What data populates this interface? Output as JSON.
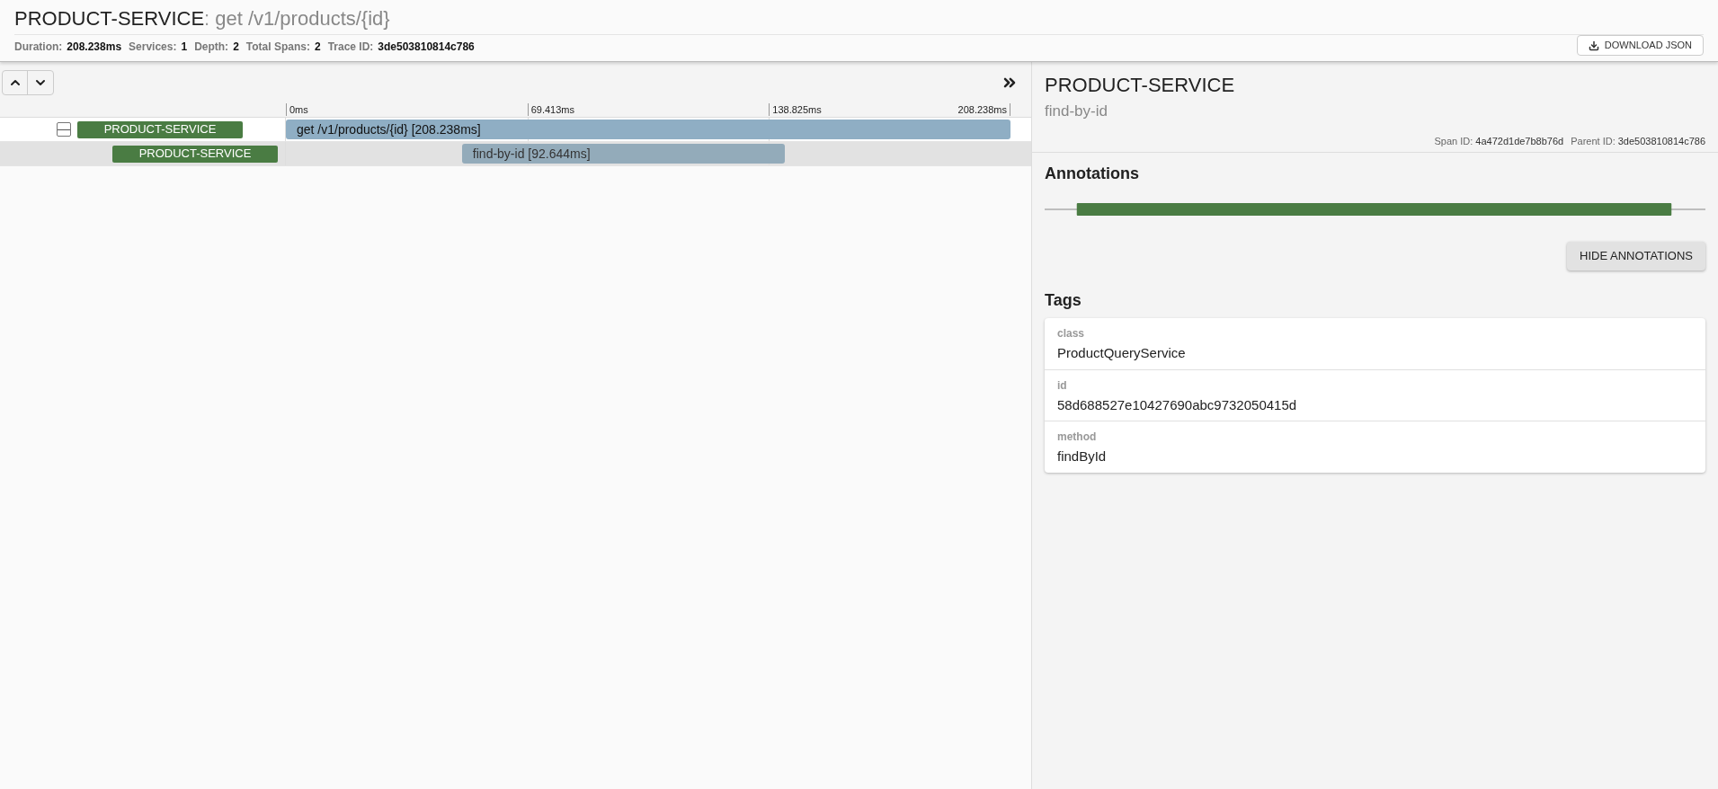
{
  "header": {
    "service": "PRODUCT-SERVICE",
    "separator": ":",
    "operation": "get /v1/products/{id}",
    "stats": [
      {
        "label": "Duration:",
        "value": "208.238ms"
      },
      {
        "label": "Services:",
        "value": "1"
      },
      {
        "label": "Depth:",
        "value": "2"
      },
      {
        "label": "Total Spans:",
        "value": "2"
      },
      {
        "label": "Trace ID:",
        "value": "3de503810814c786"
      }
    ],
    "download_button": "DOWNLOAD JSON"
  },
  "timeline": {
    "ticks": [
      "0ms",
      "69.413ms",
      "138.825ms",
      "208.238ms"
    ],
    "spans": [
      {
        "service": "PRODUCT-SERVICE",
        "label": "get /v1/products/{id} [208.238ms]",
        "selected": false,
        "expanded": true,
        "children": [
          {
            "service": "PRODUCT-SERVICE",
            "label": "find-by-id [92.644ms]",
            "selected": true
          }
        ]
      }
    ]
  },
  "detail": {
    "service": "PRODUCT-SERVICE",
    "span_name": "find-by-id",
    "ids": [
      {
        "label": "Span ID:",
        "value": "4a472d1de7b8b76d"
      },
      {
        "label": "Parent ID:",
        "value": "3de503810814c786"
      }
    ],
    "annotations_title": "Annotations",
    "hide_button": "HIDE ANNOTATIONS",
    "tags_title": "Tags",
    "tags": [
      {
        "key": "class",
        "value": "ProductQueryService"
      },
      {
        "key": "id",
        "value": "58d688527e10427690abc9732050415d"
      },
      {
        "key": "method",
        "value": "findById"
      }
    ]
  }
}
